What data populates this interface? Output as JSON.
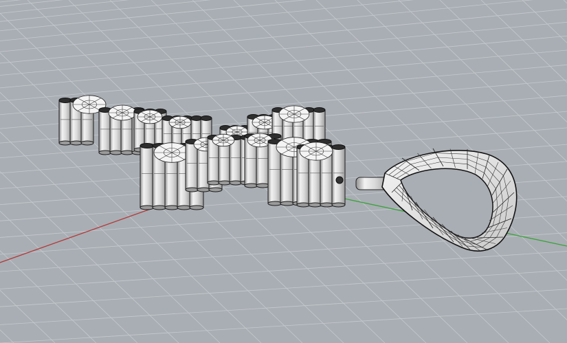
{
  "viewport": {
    "projection": "perspective",
    "background": "#a9aeb4",
    "grid": true,
    "grid_color": "#c6cacf",
    "axis_x_color": "#b23a3a",
    "axis_y_color": "#3aa23a"
  },
  "scene": {
    "objects": [
      {
        "kind": "cross-pendant",
        "style": "shaded",
        "color": "#d9d9d9",
        "gems": "round-brilliant"
      },
      {
        "kind": "bail-loop",
        "style": "wireframe-shaded",
        "color": "#e8e8e8"
      }
    ]
  }
}
